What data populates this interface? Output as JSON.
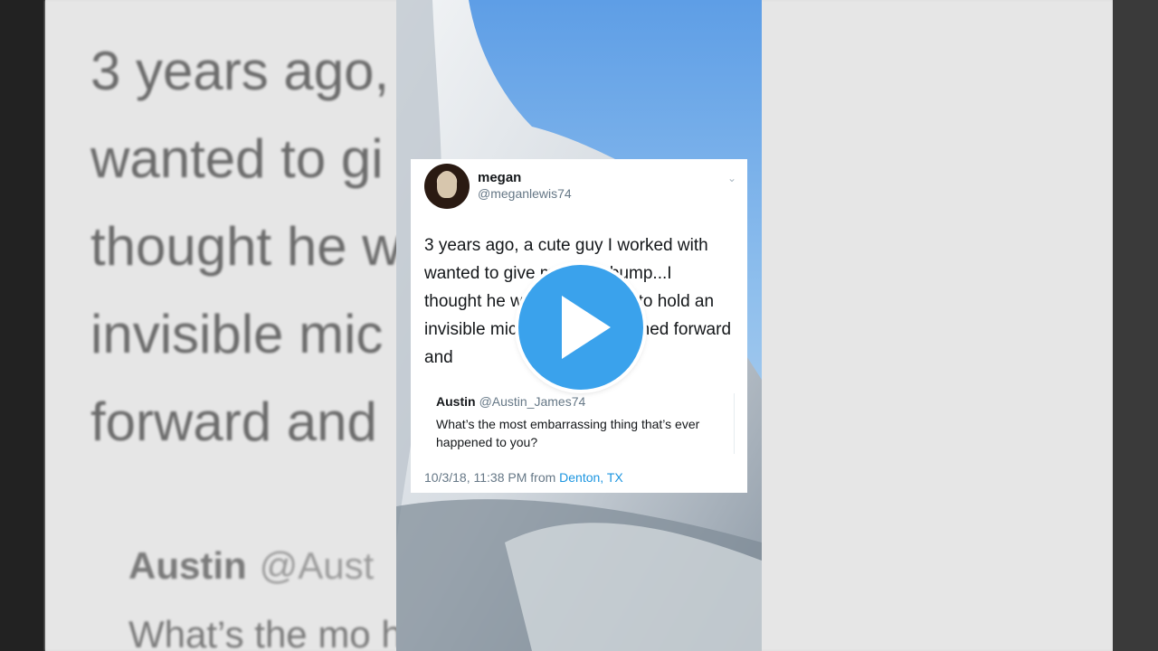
{
  "tweet": {
    "name": "megan",
    "handle": "@meganlewis74",
    "text": "3 years ago, a cute guy I worked with wanted to give me a fist bump...I thought he was wanting me to hold an invisible microphone so I leaned forward and",
    "quote": {
      "name": "Austin",
      "handle": "@Austin_James74",
      "text": "What’s the most embarrassing thing that’s ever happened to you?"
    },
    "timestamp": "10/3/18, 11:38 PM from",
    "location": "Denton, TX"
  },
  "background": {
    "text": "3 years ago,              orked with\nwanted to gi                  mp...I\nthought he w                  to hold an\ninvisible mic                  eaned\nforward and",
    "quote_name": "Austin",
    "quote_handle": "@Aust",
    "quote_text": "What’s the mo                    hing that’s"
  },
  "colors": {
    "play_button": "#3aa2ec",
    "link": "#1b95e0"
  },
  "icons": [
    "play-icon",
    "chevron-down-icon"
  ]
}
